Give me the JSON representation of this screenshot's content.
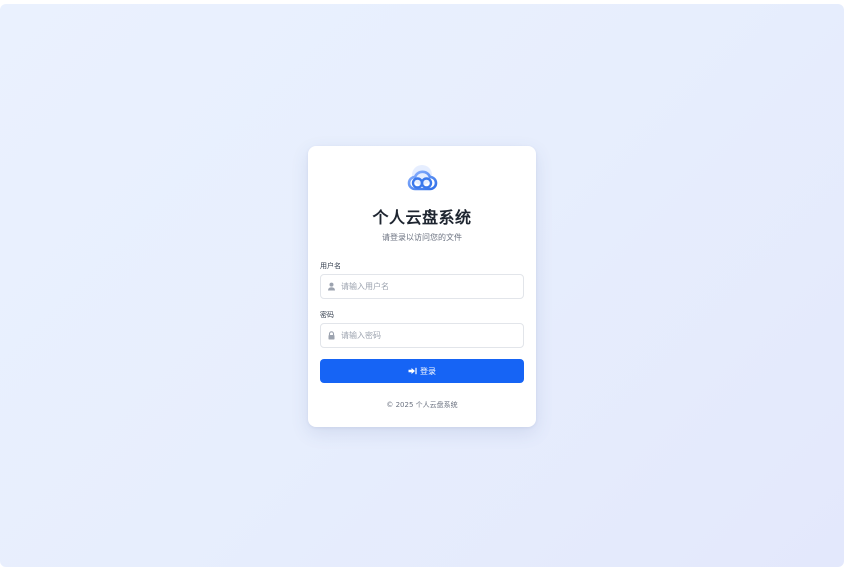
{
  "app": {
    "title": "个人云盘系统",
    "subtitle": "请登录以访问您的文件",
    "logo_icon": "cloud-icon",
    "accent_color": "#1664f5"
  },
  "form": {
    "username": {
      "label": "用户名",
      "placeholder": "请输入用户名",
      "value": "",
      "icon": "user-icon"
    },
    "password": {
      "label": "密码",
      "placeholder": "请输入密码",
      "value": "",
      "icon": "lock-icon"
    },
    "submit": {
      "label": "登录",
      "icon": "sign-in-icon"
    }
  },
  "footer": {
    "copyright": "© 2025 个人云盘系统"
  }
}
